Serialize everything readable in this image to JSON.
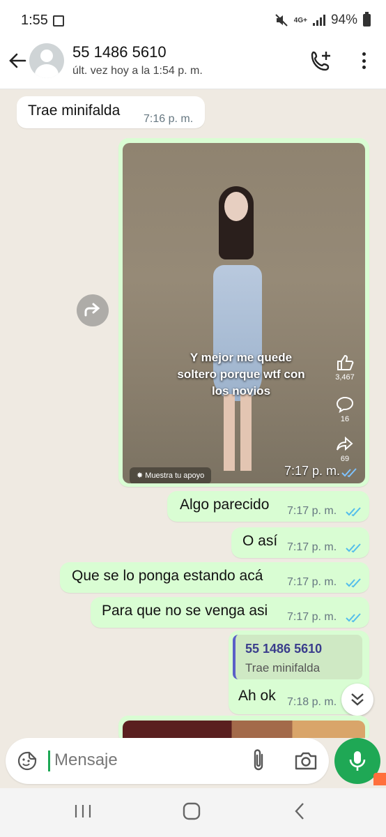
{
  "status_bar": {
    "time": "1:55",
    "network": "4G+",
    "battery": "94%"
  },
  "header": {
    "contact_name": "55 1486 5610",
    "last_seen": "últ. vez hoy a la 1:54 p. m."
  },
  "messages": [
    {
      "direction": "in",
      "text": "Trae minifalda",
      "time": "7:16 p. m."
    },
    {
      "direction": "out",
      "type": "media",
      "time": "7:17 p. m.",
      "caption": "Y mejor me quede\nsoltero porque wtf con\nlos novios",
      "likes": "3,467",
      "comments": "16",
      "shares": "69",
      "support_label": "Muestra tu apoyo"
    },
    {
      "direction": "out",
      "text": "Algo parecido",
      "time": "7:17 p. m."
    },
    {
      "direction": "out",
      "text": "O así",
      "time": "7:17 p. m."
    },
    {
      "direction": "out",
      "text": "Que se lo ponga estando acá",
      "time": "7:17 p. m."
    },
    {
      "direction": "out",
      "text": "Para que no se venga asi",
      "time": "7:17 p. m."
    },
    {
      "direction": "out",
      "text": "Ah ok",
      "time": "7:18 p. m.",
      "quote": {
        "name": "55 1486 5610",
        "text": "Trae minifalda"
      }
    }
  ],
  "input": {
    "placeholder": "Mensaje"
  },
  "colors": {
    "outgoing_bubble": "#d9fdd3",
    "incoming_bubble": "#ffffff",
    "chat_background": "#efeae2",
    "accent_green": "#1fa855",
    "read_tick": "#53bdeb"
  }
}
